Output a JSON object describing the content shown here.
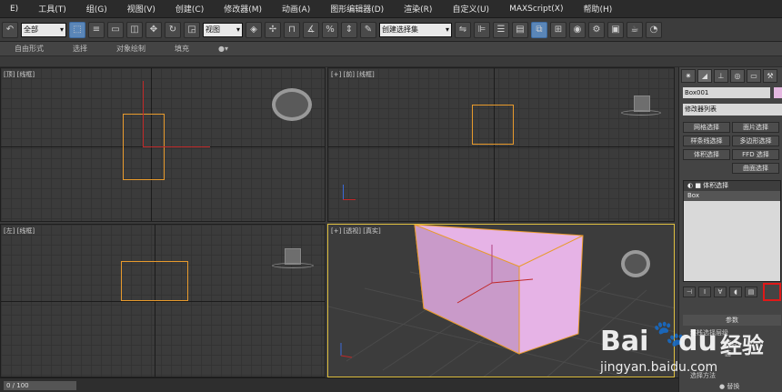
{
  "menus": [
    "E)",
    "工具(T)",
    "组(G)",
    "视图(V)",
    "创建(C)",
    "修改器(M)",
    "动画(A)",
    "图形编辑器(D)",
    "渲染(R)",
    "自定义(U)",
    "MAXScript(X)",
    "帮助(H)"
  ],
  "toolbar": {
    "filter_value": "全部",
    "coord_value": "视图",
    "selection_set_placeholder": "创建选择集"
  },
  "ribbon": [
    "自由形式",
    "选择",
    "对象绘制",
    "填充"
  ],
  "viewports": {
    "top_left_label": "[顶] [线框]",
    "front_label": "[+] [前] [线框]",
    "left_label": "[左] [线框]",
    "persp_label": "[+] [透视] [真实]"
  },
  "cmd_panel": {
    "object_name": "Box001",
    "object_color": "#e4b8e0",
    "modifier_list": "修改器列表",
    "mod_buttons": [
      "网格选择",
      "面片选择",
      "样条线选择",
      "多边形选择",
      "体积选择",
      "FFD 选择",
      "曲面选择"
    ],
    "stack_items": [
      "体积选择",
      "Box"
    ],
    "params_title": "参数",
    "params_lines": [
      "堆栈选择层级",
      "顶点",
      "面",
      "选择方法",
      "替换"
    ]
  },
  "status": {
    "time": "0 / 100"
  },
  "watermark": {
    "brand_a": "Bai",
    "brand_b": "du",
    "brand_c": "经验",
    "url": "jingyan.baidu.com"
  }
}
